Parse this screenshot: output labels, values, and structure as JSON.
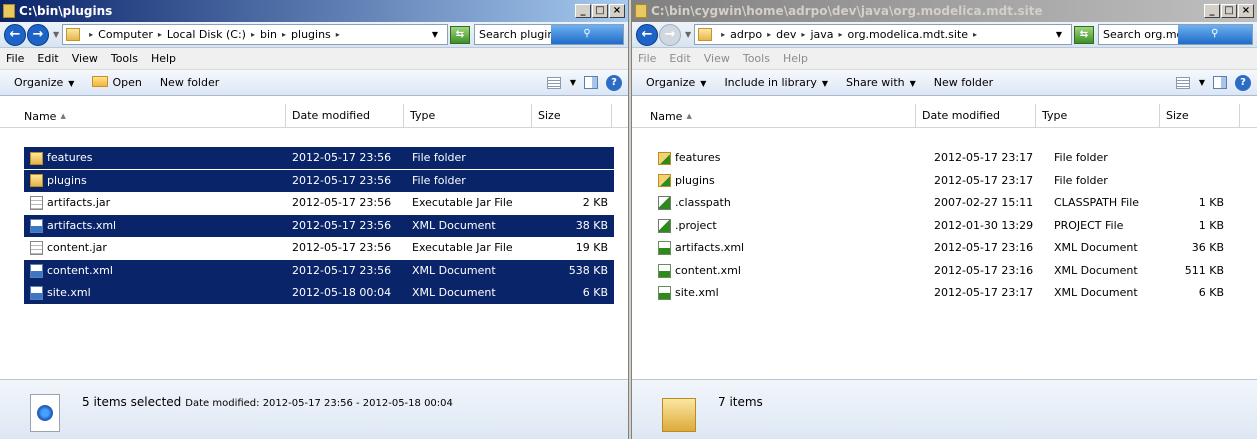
{
  "left": {
    "title": "C:\\bin\\plugins",
    "breadcrumb": [
      "Computer",
      "Local Disk (C:)",
      "bin",
      "plugins"
    ],
    "search_placeholder": "Search plugins",
    "menu": [
      "File",
      "Edit",
      "View",
      "Tools",
      "Help"
    ],
    "toolbar": {
      "organize": "Organize",
      "open": "Open",
      "new_folder": "New folder"
    },
    "columns": [
      "Name",
      "Date modified",
      "Type",
      "Size"
    ],
    "files": [
      {
        "name": "features",
        "date": "2012-05-17 23:56",
        "type": "File folder",
        "size": "",
        "icon": "folder-icon",
        "selected": true
      },
      {
        "name": "plugins",
        "date": "2012-05-17 23:56",
        "type": "File folder",
        "size": "",
        "icon": "folder-icon",
        "selected": true
      },
      {
        "name": "artifacts.jar",
        "date": "2012-05-17 23:56",
        "type": "Executable Jar File",
        "size": "2 KB",
        "icon": "jar-file-icon",
        "selected": false
      },
      {
        "name": "artifacts.xml",
        "date": "2012-05-17 23:56",
        "type": "XML Document",
        "size": "38 KB",
        "icon": "xml-file-icon",
        "selected": true
      },
      {
        "name": "content.jar",
        "date": "2012-05-17 23:56",
        "type": "Executable Jar File",
        "size": "19 KB",
        "icon": "jar-file-icon",
        "selected": false
      },
      {
        "name": "content.xml",
        "date": "2012-05-17 23:56",
        "type": "XML Document",
        "size": "538 KB",
        "icon": "xml-file-icon",
        "selected": true
      },
      {
        "name": "site.xml",
        "date": "2012-05-18 00:04",
        "type": "XML Document",
        "size": "6 KB",
        "icon": "xml-file-icon",
        "selected": true
      }
    ],
    "status": {
      "count": "5 items selected",
      "detail": "Date modified: 2012-05-17 23:56 - 2012-05-18 00:04"
    }
  },
  "right": {
    "title": "C:\\bin\\cygwin\\home\\adrpo\\dev\\java\\org.modelica.mdt.site",
    "breadcrumb": [
      "adrpo",
      "dev",
      "java",
      "org.modelica.mdt.site"
    ],
    "search_placeholder": "Search org.modelica....",
    "menu": [
      "File",
      "Edit",
      "View",
      "Tools",
      "Help"
    ],
    "toolbar": {
      "organize": "Organize",
      "include": "Include in library",
      "share": "Share with",
      "new_folder": "New folder"
    },
    "columns": [
      "Name",
      "Date modified",
      "Type",
      "Size"
    ],
    "files": [
      {
        "name": "features",
        "date": "2012-05-17 23:17",
        "type": "File folder",
        "size": "",
        "icon": "versioned-folder-icon"
      },
      {
        "name": "plugins",
        "date": "2012-05-17 23:17",
        "type": "File folder",
        "size": "",
        "icon": "versioned-folder-icon"
      },
      {
        "name": ".classpath",
        "date": "2007-02-27 15:11",
        "type": "CLASSPATH File",
        "size": "1 KB",
        "icon": "versioned-file-icon"
      },
      {
        "name": ".project",
        "date": "2012-01-30 13:29",
        "type": "PROJECT File",
        "size": "1 KB",
        "icon": "versioned-file-icon"
      },
      {
        "name": "artifacts.xml",
        "date": "2012-05-17 23:16",
        "type": "XML Document",
        "size": "36 KB",
        "icon": "versioned-xml-icon"
      },
      {
        "name": "content.xml",
        "date": "2012-05-17 23:16",
        "type": "XML Document",
        "size": "511 KB",
        "icon": "versioned-xml-icon"
      },
      {
        "name": "site.xml",
        "date": "2012-05-17 23:17",
        "type": "XML Document",
        "size": "6 KB",
        "icon": "versioned-xml-icon"
      }
    ],
    "status": {
      "count": "7 items"
    }
  },
  "window_controls": {
    "minimize": "_",
    "maximize": "□",
    "close": "×"
  }
}
